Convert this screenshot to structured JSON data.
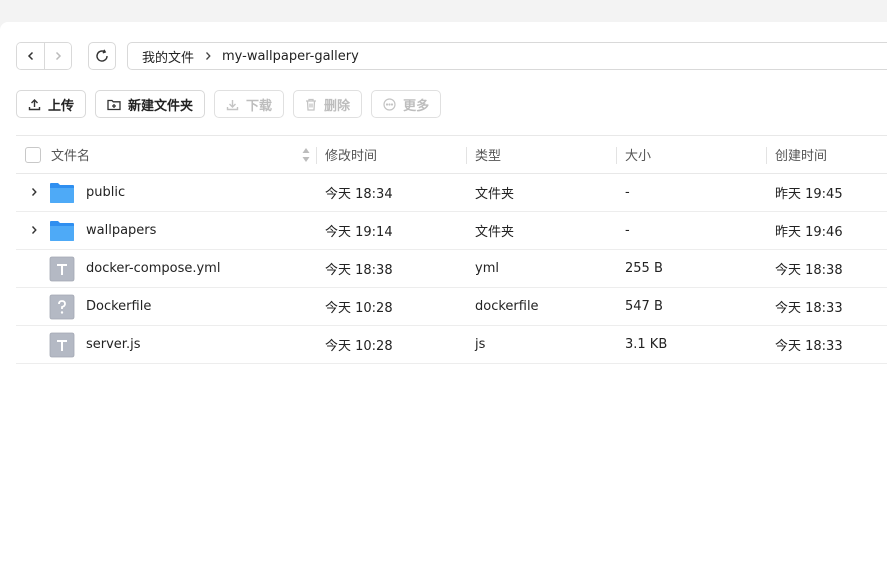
{
  "nav": {
    "back_icon": "chevron-left-icon",
    "forward_icon": "chevron-right-icon",
    "refresh_icon": "refresh-icon"
  },
  "breadcrumb": {
    "root": "我的文件",
    "separator_icon": "chevron-right-icon",
    "current": "my-wallpaper-gallery"
  },
  "toolbar": {
    "upload": "上传",
    "new_folder": "新建文件夹",
    "download": "下载",
    "delete": "删除",
    "more": "更多"
  },
  "table": {
    "headers": {
      "name": "文件名",
      "mtime": "修改时间",
      "type": "类型",
      "size": "大小",
      "ctime": "创建时间"
    },
    "rows": [
      {
        "name": "public",
        "mtime": "今天 18:34",
        "type": "文件夹",
        "size": "-",
        "ctime": "昨天 19:45",
        "icon": "folder-icon"
      },
      {
        "name": "wallpapers",
        "mtime": "今天 19:14",
        "type": "文件夹",
        "size": "-",
        "ctime": "昨天 19:46",
        "icon": "folder-icon"
      },
      {
        "name": "docker-compose.yml",
        "mtime": "今天 18:38",
        "type": "yml",
        "size": "255 B",
        "ctime": "今天 18:38",
        "icon": "text-file-icon"
      },
      {
        "name": "Dockerfile",
        "mtime": "今天 10:28",
        "type": "dockerfile",
        "size": "547 B",
        "ctime": "今天 18:33",
        "icon": "unknown-file-icon"
      },
      {
        "name": "server.js",
        "mtime": "今天 10:28",
        "type": "js",
        "size": "3.1 KB",
        "ctime": "今天 18:33",
        "icon": "text-file-icon"
      }
    ]
  },
  "colors": {
    "folder": "#3a9bf0",
    "file": "#b4b9c4",
    "border": "#d9d9d9",
    "disabled_text": "#bdbdbd"
  }
}
